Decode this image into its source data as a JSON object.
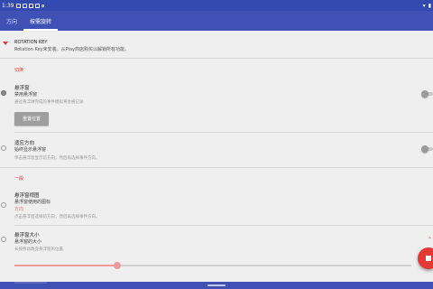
{
  "status_bar": {
    "time": "1:39",
    "icons": [
      "notification-icon",
      "settings-icon",
      "android-icon",
      "sync-icon",
      "dot-icon"
    ],
    "right_icons": [
      "wifi-icon",
      "battery-icon"
    ]
  },
  "tabs": [
    {
      "label": "方向"
    },
    {
      "label": "按需旋转"
    }
  ],
  "banner": {
    "title": "ROTATION KEY",
    "text": "Rotation Key未安装。从Play商店购买以解锁所有功能。"
  },
  "section_switch": {
    "title": "切换",
    "floating": {
      "title": "悬浮窗",
      "subtitle": "禁用悬浮窗",
      "desc": "通过悬浮球完成的事件模拟将会被记录",
      "button": "重置位置",
      "switch_on": false
    },
    "adapt": {
      "title": "适应方向",
      "subtitle": "始终显示悬浮窗",
      "desc": "单击悬浮窗显示前方向，然后再选择事件方向。",
      "switch_on": false
    }
  },
  "section_general": {
    "title": "一般",
    "view": {
      "title": "悬浮窗视图",
      "subtitle": "悬浮窗使用的图标",
      "value": "方向",
      "desc": "点击悬浮窗选择前方向，然后再选择事件方向。"
    },
    "size": {
      "title": "悬浮窗大小",
      "subtitle": "悬浮窗的大小",
      "desc": "长按移动改变悬浮窗的位置",
      "value_fraction": 0.26
    }
  },
  "colors": {
    "appbar": "#3f51b5",
    "statusbar": "#3249b0",
    "accent": "#e53935"
  }
}
